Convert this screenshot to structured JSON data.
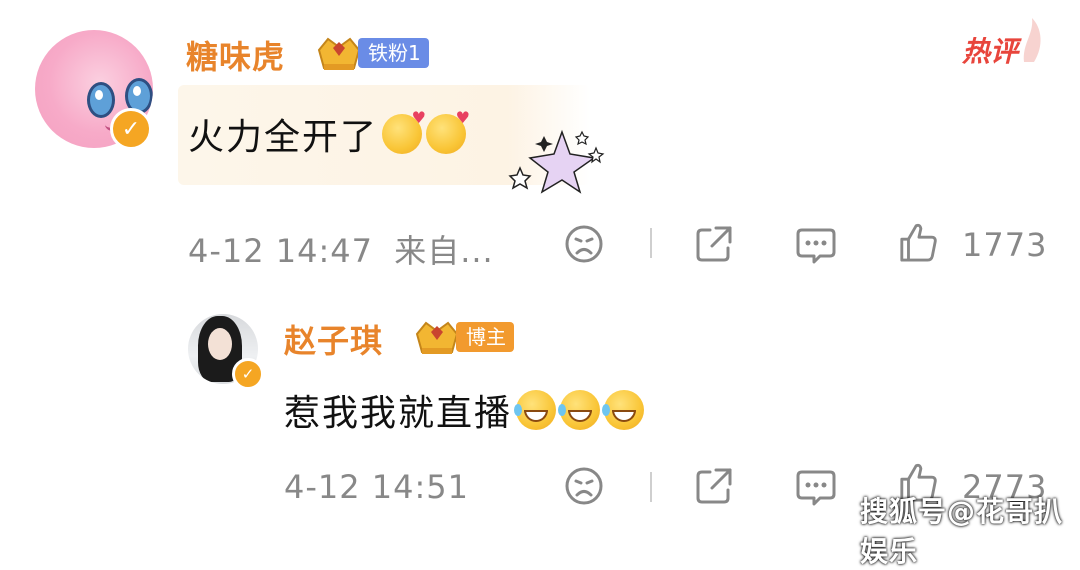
{
  "comment": {
    "username": "糖味虎",
    "fan_badge": "铁粉1",
    "hot_label": "热评",
    "text": "火力全开了",
    "emojis": [
      "pray-heart-emoji",
      "pray-heart-emoji"
    ],
    "date": "4-12 14:47",
    "source": "来自...",
    "likes": "1773"
  },
  "reply": {
    "username": "赵子琪",
    "role_badge": "博主",
    "text": "惹我我就直播",
    "emojis": [
      "laugh-cry-emoji",
      "laugh-cry-emoji",
      "laugh-cry-emoji"
    ],
    "date": "4-12 14:51",
    "likes": "2773"
  },
  "watermark": "搜狐号@花哥扒娱乐",
  "colors": {
    "username": "#e8842b",
    "fan_badge_bg": "#6a8ce6",
    "role_badge_bg": "#f29a2e",
    "hot": "#e8453c",
    "meta": "#888888",
    "verified_badge": "#f5a623"
  }
}
